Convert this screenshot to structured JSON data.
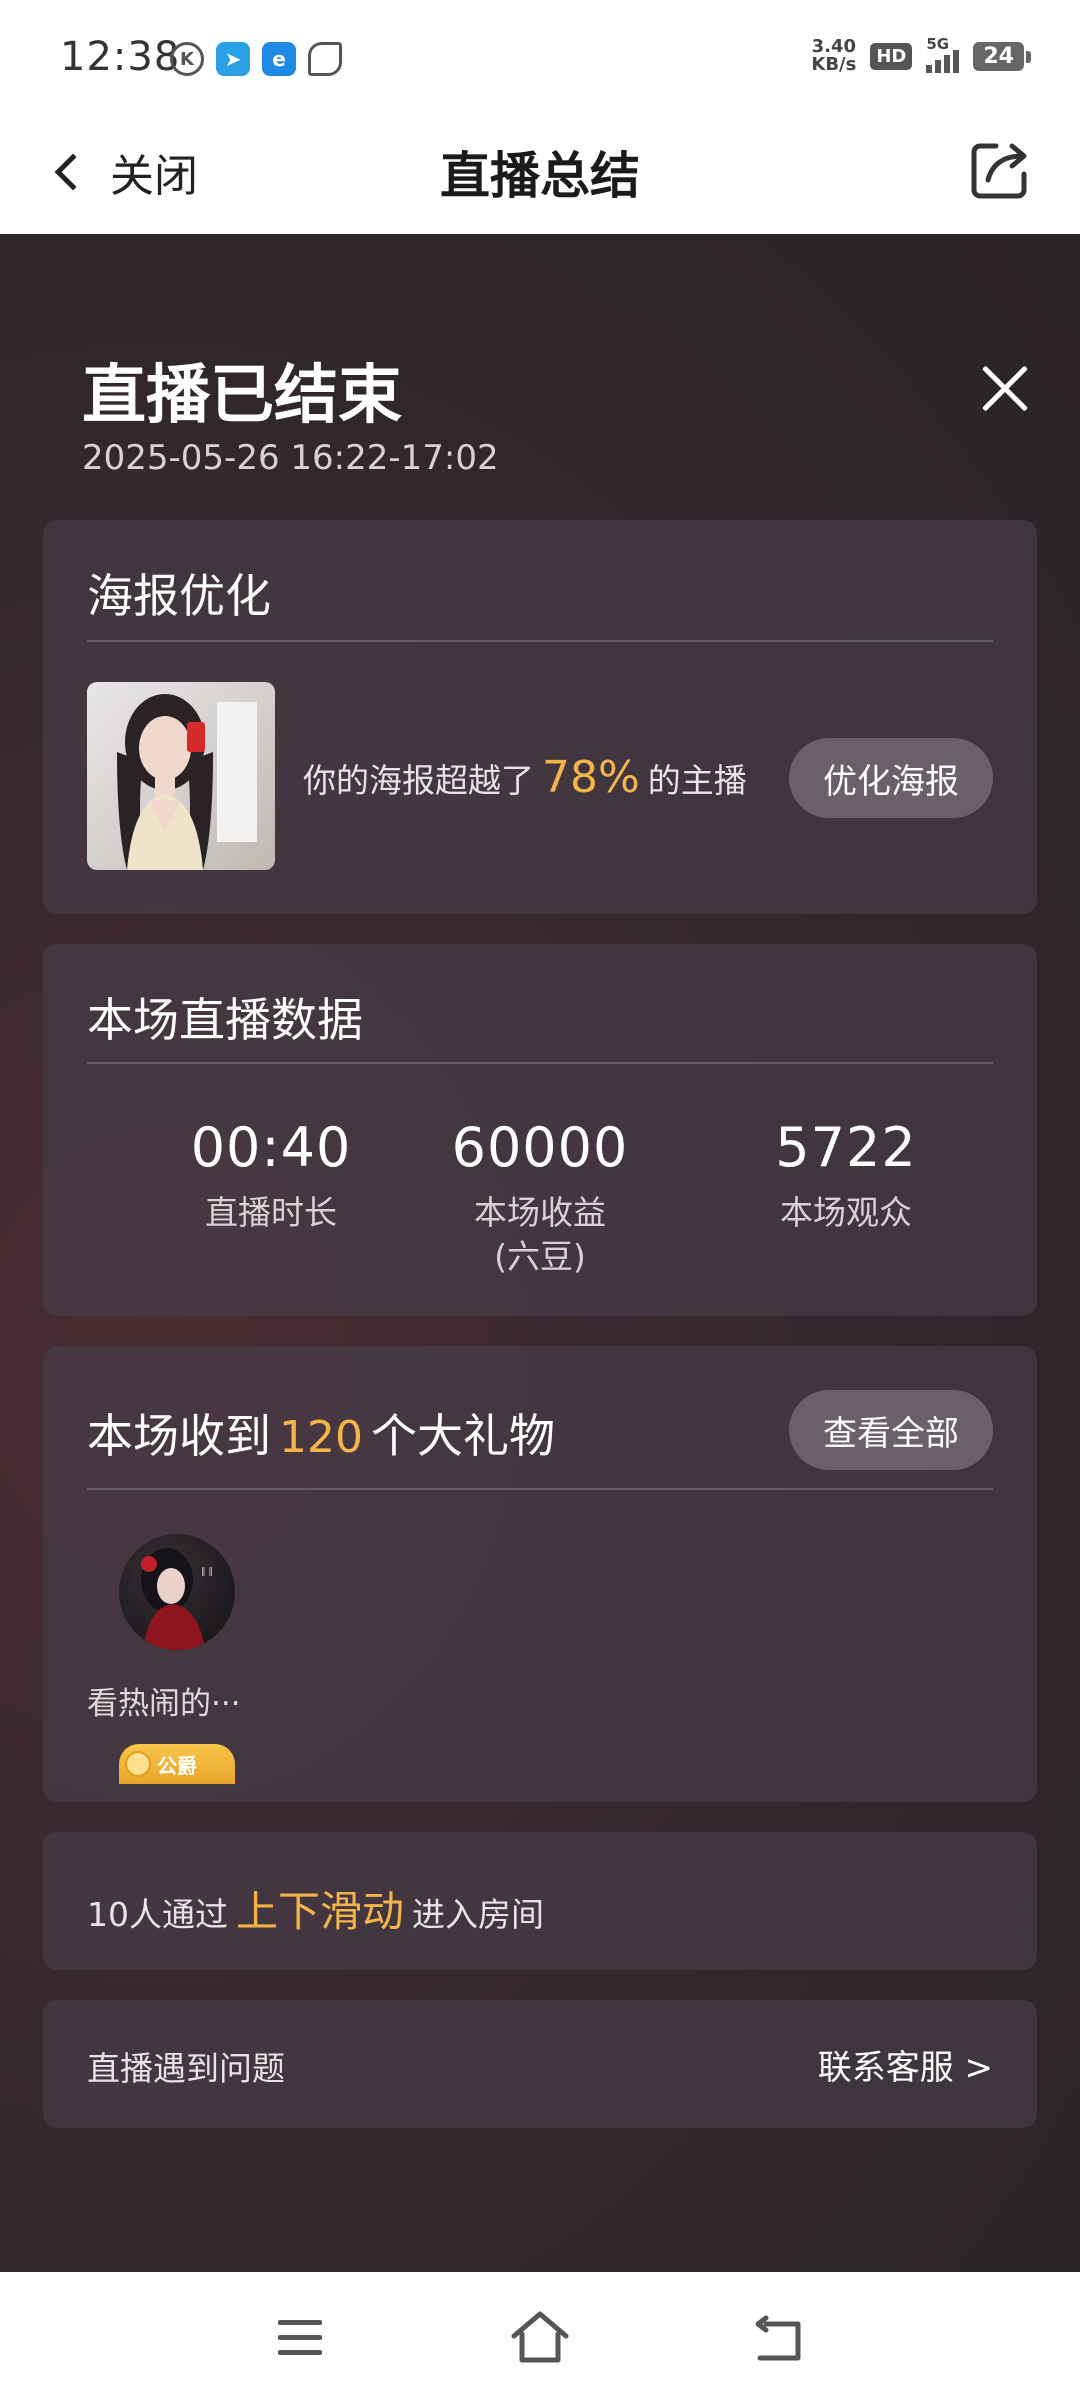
{
  "status_bar": {
    "time": "12:38",
    "net_speed_value": "3.40",
    "net_speed_unit": "KB/s",
    "hd_label": "HD",
    "network_label": "5G",
    "battery_level": "24"
  },
  "header": {
    "back_label": "关闭",
    "title": "直播总结"
  },
  "summary": {
    "title": "直播已结束",
    "time_range": "2025-05-26 16:22-17:02"
  },
  "poster": {
    "title": "海报优化",
    "text_before": "你的海报超越了",
    "percent": "78%",
    "text_after": "的主播",
    "button_label": "优化海报"
  },
  "stats": {
    "title": "本场直播数据",
    "items": [
      {
        "value": "00:40",
        "label": "直播时长"
      },
      {
        "value": "60000",
        "label": "本场收益\n(六豆)"
      },
      {
        "value": "5722",
        "label": "本场观众"
      }
    ]
  },
  "gifts": {
    "title_before": "本场收到",
    "count": "120",
    "title_after": "个大礼物",
    "button_label": "查看全部",
    "top_gifter_name": "看热闹的···",
    "badge_text": "公爵"
  },
  "swipe": {
    "text_before": "10人通过",
    "highlight": "上下滑动",
    "text_after": "进入房间"
  },
  "problem": {
    "text": "直播遇到问题",
    "link": "联系客服 >"
  },
  "colors": {
    "accent": "#f5b44a",
    "panel_bg": "#2e2629",
    "card_bg": "#463c46",
    "button_bg": "#6b5f69"
  }
}
